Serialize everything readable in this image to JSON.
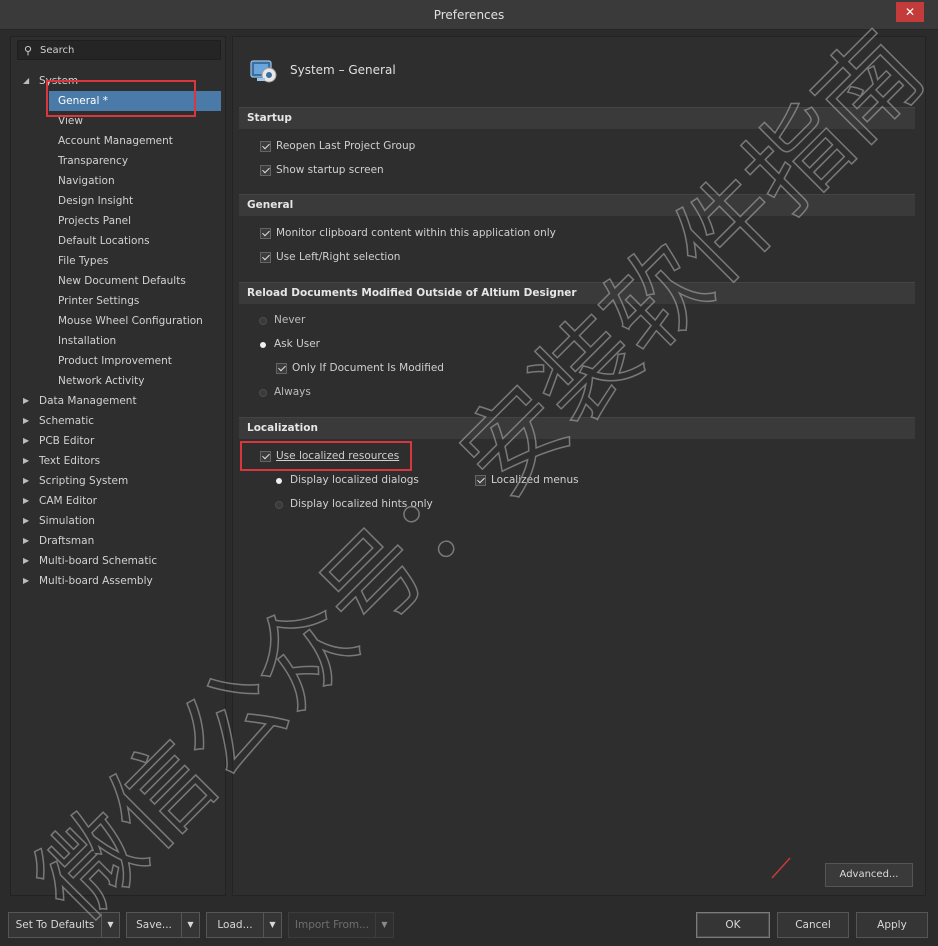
{
  "window": {
    "title": "Preferences",
    "close_label": "✕"
  },
  "search": {
    "placeholder": "Search"
  },
  "tree": {
    "items": [
      {
        "label": "System",
        "arrow": "◢"
      },
      {
        "label": "General *"
      },
      {
        "label": "View"
      },
      {
        "label": "Account Management"
      },
      {
        "label": "Transparency"
      },
      {
        "label": "Navigation"
      },
      {
        "label": "Design Insight"
      },
      {
        "label": "Projects Panel"
      },
      {
        "label": "Default Locations"
      },
      {
        "label": "File Types"
      },
      {
        "label": "New Document Defaults"
      },
      {
        "label": "Printer Settings"
      },
      {
        "label": "Mouse Wheel Configuration"
      },
      {
        "label": "Installation"
      },
      {
        "label": "Product Improvement"
      },
      {
        "label": "Network Activity"
      },
      {
        "label": "Data Management",
        "arrow": "▶"
      },
      {
        "label": "Schematic",
        "arrow": "▶"
      },
      {
        "label": "PCB Editor",
        "arrow": "▶"
      },
      {
        "label": "Text Editors",
        "arrow": "▶"
      },
      {
        "label": "Scripting System",
        "arrow": "▶"
      },
      {
        "label": "CAM Editor",
        "arrow": "▶"
      },
      {
        "label": "Simulation",
        "arrow": "▶"
      },
      {
        "label": "Draftsman",
        "arrow": "▶"
      },
      {
        "label": "Multi-board Schematic",
        "arrow": "▶"
      },
      {
        "label": "Multi-board Assembly",
        "arrow": "▶"
      }
    ]
  },
  "page": {
    "title": "System – General"
  },
  "sections": {
    "startup": {
      "title": "Startup",
      "reopen_last_project_group": {
        "label": "Reopen Last Project Group",
        "checked": true
      },
      "show_startup_screen": {
        "label": "Show startup screen",
        "checked": true
      }
    },
    "general": {
      "title": "General",
      "monitor_clipboard": {
        "label": "Monitor clipboard content within this application only",
        "checked": true
      },
      "left_right_selection": {
        "label": "Use Left/Right selection",
        "checked": true
      }
    },
    "reload": {
      "title": "Reload Documents Modified Outside of Altium Designer",
      "never": {
        "label": "Never",
        "selected": false
      },
      "ask_user": {
        "label": "Ask User",
        "selected": true
      },
      "only_if_modified": {
        "label": "Only If Document Is Modified",
        "checked": true
      },
      "always": {
        "label": "Always",
        "selected": false
      }
    },
    "localization": {
      "title": "Localization",
      "use_localized_resources": {
        "label": "Use localized resources",
        "checked": true
      },
      "display_localized_dialogs": {
        "label": "Display localized dialogs",
        "selected": true
      },
      "display_localized_hints": {
        "label": "Display localized hints only",
        "selected": false
      },
      "localized_menus": {
        "label": "Localized menus",
        "checked": true
      }
    }
  },
  "buttons": {
    "advanced": "Advanced...",
    "set_to_defaults": "Set To Defaults",
    "save": "Save...",
    "load": "Load...",
    "import_from": "Import From...",
    "ok": "OK",
    "cancel": "Cancel",
    "apply": "Apply",
    "dropdown_glyph": "▼"
  },
  "watermark": {
    "text": "微信公众号：安装软件指南"
  },
  "colors": {
    "background": "#2b2b2b",
    "panel": "#2e2e2e",
    "section_header": "#3a3a3a",
    "selection": "#4a7aa8",
    "annotation_red": "#d9363e",
    "close_button": "#c43b3b"
  }
}
